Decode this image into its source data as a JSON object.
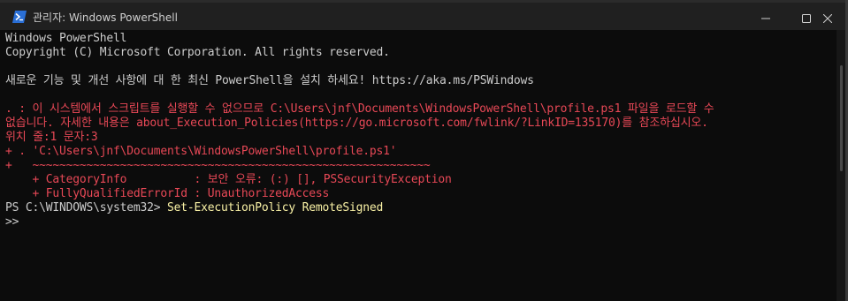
{
  "window": {
    "title": "관리자: Windows PowerShell",
    "icon": "powershell-icon",
    "controls": [
      "minimize-icon",
      "maximize-icon",
      "close-icon"
    ]
  },
  "console": {
    "lines": [
      "Windows PowerShell",
      "Copyright (C) Microsoft Corporation. All rights reserved.",
      "",
      "새로운 기능 및 개선 사항에 대 한 최신 PowerShell을 설치 하세요! https://aka.ms/PSWindows",
      "",
      ". : 이 시스템에서 스크립트를 실행할 수 없으므로 C:\\Users\\jnf\\Documents\\WindowsPowerShell\\profile.ps1 파일을 로드할 수",
      "없습니다. 자세한 내용은 about_Execution_Policies(https://go.microsoft.com/fwlink/?LinkID=135170)를 참조하십시오.",
      "위치 줄:1 문자:3",
      "+ . 'C:\\Users\\jnf\\Documents\\WindowsPowerShell\\profile.ps1'",
      "+   ~~~~~~~~~~~~~~~~~~~~~~~~~~~~~~~~~~~~~~~~~~~~~~~~~~~~~~~~~~~",
      "    + CategoryInfo          : 보안 오류: (:) [], PSSecurityException",
      "    + FullyQualifiedErrorId : UnauthorizedAccess",
      "PS C:\\WINDOWS\\system32> ",
      ">>"
    ],
    "prompt": "PS C:\\WINDOWS\\system32> ",
    "command": "Set-ExecutionPolicy RemoteSigned",
    "continuation_prompt": ">>"
  },
  "colors": {
    "background": "#0c0c0c",
    "text": "#cccccc",
    "error": "#e74856",
    "command": "#f9f1a5",
    "titlebar": "#202020"
  }
}
